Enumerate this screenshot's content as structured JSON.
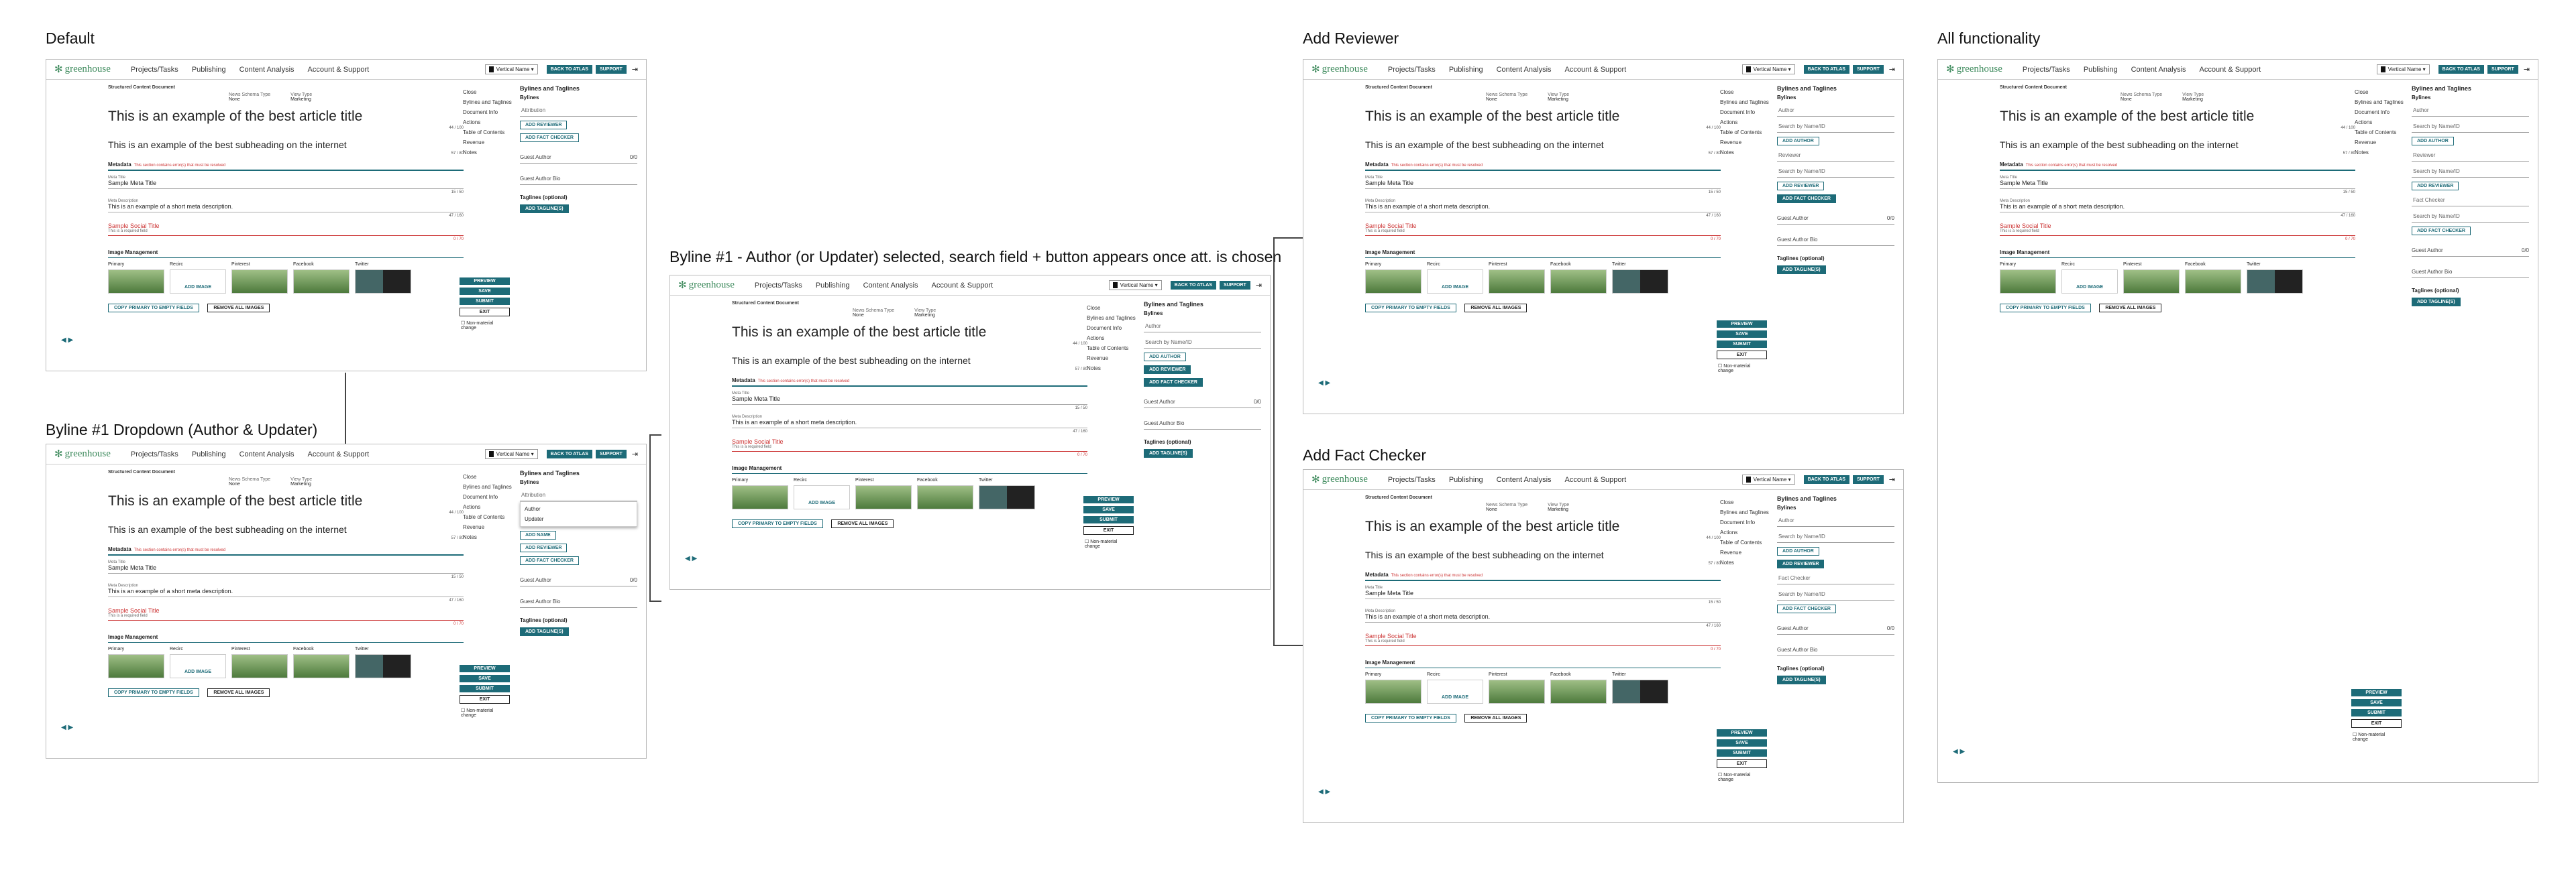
{
  "labels": {
    "default": "Default",
    "byline_dropdown": "Byline #1 Dropdown (Author & Updater)",
    "byline_selected": "Byline #1 - Author (or Updater) selected, search field + button appears once att. is chosen",
    "add_reviewer": "Add Reviewer",
    "add_fact_checker": "Add Fact Checker",
    "all_functionality": "All functionality"
  },
  "header": {
    "logo": "greenhouse",
    "nav": [
      "Projects/Tasks",
      "Publishing",
      "Content Analysis",
      "Account & Support"
    ],
    "vertical": "Vertical Name",
    "back": "BACK TO ATLAS",
    "support": "SUPPORT"
  },
  "doc": {
    "section": "Structured Content Document",
    "news_schema_label": "News Schema Type",
    "news_schema": "None",
    "view_type_label": "View Type",
    "view_type": "Marketing",
    "title": "This is an example of the best article title",
    "title_count": "44 / 100",
    "subheading": "This is an example of the best subheading on the internet",
    "sub_count": "57 / 80",
    "metadata": "Metadata",
    "metadata_error": "This section contains error(s) that must be resolved",
    "meta_title_label": "Meta Title",
    "meta_title": "Sample Meta Title",
    "meta_title_count": "15 / 50",
    "meta_desc_label": "Meta Description",
    "meta_desc": "This is an example of a short meta description.",
    "meta_desc_count": "47 / 160",
    "social_title": "Sample Social Title",
    "required": "This is a required field",
    "social_count": "0 / 70",
    "image_mgmt": "Image Management",
    "tiles": [
      "Primary",
      "Recirc",
      "Pinterest",
      "Facebook",
      "Twitter"
    ],
    "add_image": "ADD IMAGE",
    "copy_primary": "COPY PRIMARY TO EMPTY FIELDS",
    "remove_all": "REMOVE ALL IMAGES"
  },
  "sidebar": [
    "Close",
    "Bylines and Taglines",
    "Document Info",
    "Actions",
    "Table of Contents",
    "Revenue",
    "Notes"
  ],
  "panel": {
    "heading": "Bylines and Taglines",
    "bylines": "Bylines",
    "attribution": "Attribution",
    "author": "Author",
    "updater": "Updater",
    "reviewer": "Reviewer",
    "fact_checker": "Fact Checker",
    "search": "Search by Name/ID",
    "add_author": "ADD AUTHOR",
    "add_name": "ADD NAME",
    "add_reviewer": "ADD REVIEWER",
    "add_fact_checker": "ADD FACT CHECKER",
    "guest_author": "Guest Author",
    "guest_count": "0/0",
    "guest_bio": "Guest Author Bio",
    "taglines": "Taglines (optional)",
    "add_tagline": "ADD TAGLINE",
    "add_taglines": "ADD TAGLINE(S)"
  },
  "actions": {
    "preview": "PREVIEW",
    "save": "SAVE",
    "submit": "SUBMIT",
    "exit": "EXIT",
    "non_material": "Non-material change"
  }
}
